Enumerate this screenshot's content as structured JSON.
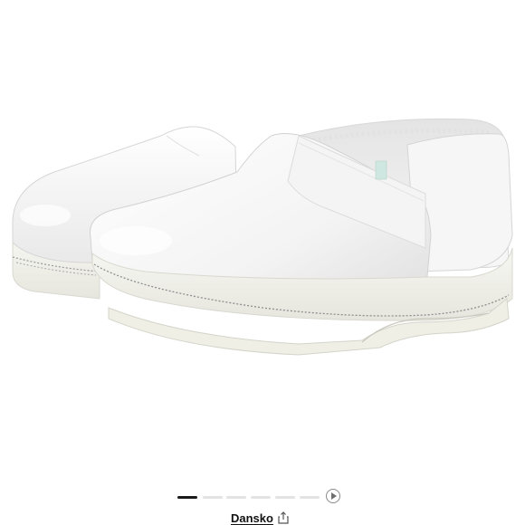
{
  "product": {
    "brand": "Dansko",
    "image_icon": "white-clogs-photo"
  },
  "carousel": {
    "slide_count": 6,
    "active_index": 0,
    "play_icon": "play-circle-icon"
  },
  "icons": {
    "share": "share-icon",
    "top_corner": "menu-button-icon"
  },
  "colors": {
    "active_dot": "#1b1b1b",
    "inactive_dot": "#e3e3e3",
    "text": "#111111"
  }
}
